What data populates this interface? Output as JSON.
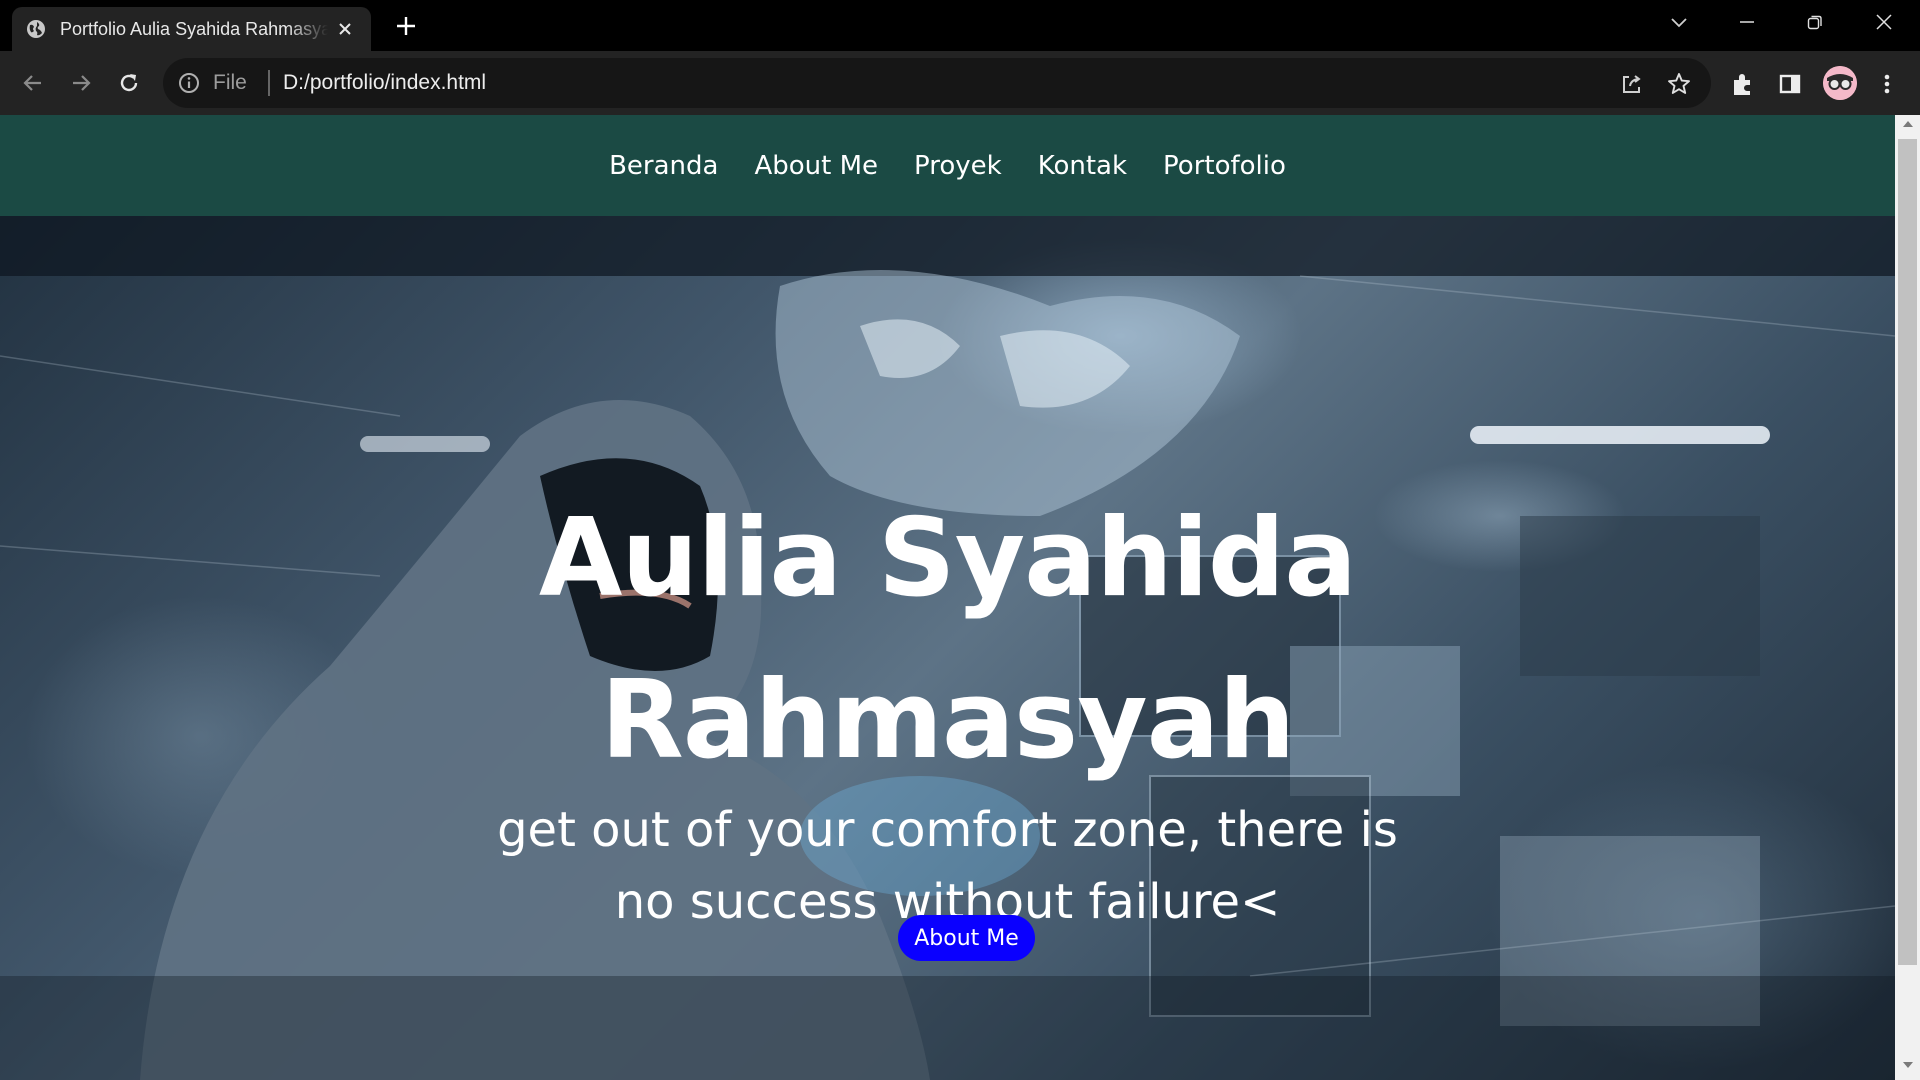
{
  "browser": {
    "tab_title": "Portfolio Aulia Syahida Rahmasyah",
    "tab_icon": "globe-icon",
    "address_scheme": "File",
    "address_url": "D:/portfolio/index.html"
  },
  "site": {
    "nav": [
      {
        "label": "Beranda"
      },
      {
        "label": "About Me"
      },
      {
        "label": "Proyek"
      },
      {
        "label": "Kontak"
      },
      {
        "label": "Portofolio"
      }
    ],
    "hero": {
      "name": "Aulia Syahida Rahmasyah",
      "tagline": "get out of your comfort zone, there is no success without failure<",
      "button_label": "About Me"
    }
  },
  "colors": {
    "nav_bg": "#1b4a44",
    "button_bg": "#0a00ff"
  }
}
